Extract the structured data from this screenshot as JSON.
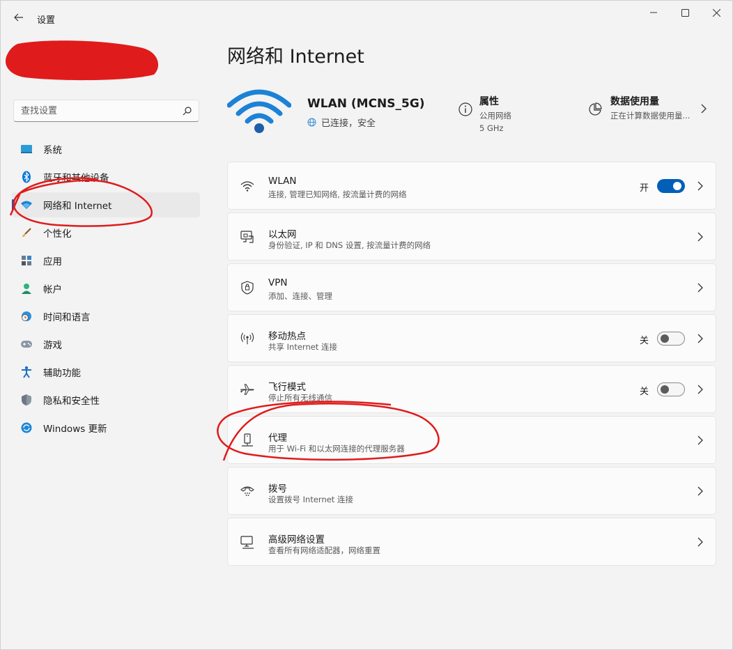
{
  "window": {
    "title": "设置",
    "controls": [
      "minimize",
      "maximize",
      "close"
    ]
  },
  "search": {
    "placeholder": "查找设置"
  },
  "sidebar": {
    "items": [
      {
        "label": "系统",
        "icon": "system-icon",
        "active": false
      },
      {
        "label": "蓝牙和其他设备",
        "icon": "bluetooth-icon",
        "active": false
      },
      {
        "label": "网络和 Internet",
        "icon": "wifi-icon",
        "active": true
      },
      {
        "label": "个性化",
        "icon": "brush-icon",
        "active": false
      },
      {
        "label": "应用",
        "icon": "apps-icon",
        "active": false
      },
      {
        "label": "帐户",
        "icon": "person-icon",
        "active": false
      },
      {
        "label": "时间和语言",
        "icon": "globe-clock-icon",
        "active": false
      },
      {
        "label": "游戏",
        "icon": "gamepad-icon",
        "active": false
      },
      {
        "label": "辅助功能",
        "icon": "accessibility-icon",
        "active": false
      },
      {
        "label": "隐私和安全性",
        "icon": "shield-icon",
        "active": false
      },
      {
        "label": "Windows 更新",
        "icon": "update-icon",
        "active": false
      }
    ]
  },
  "main": {
    "title": "网络和 Internet",
    "network": {
      "name": "WLAN (MCNS_5G)",
      "status": "已连接，安全",
      "properties": {
        "title": "属性",
        "line1": "公用网络",
        "line2": "5 GHz"
      },
      "usage": {
        "title": "数据使用量",
        "line1": "正在计算数据使用量..."
      }
    },
    "cards": [
      {
        "title": "WLAN",
        "subtitle": "连接, 管理已知网络, 按流量计费的网络",
        "icon": "wifi-icon",
        "toggle": "开"
      },
      {
        "title": "以太网",
        "subtitle": "身份验证, IP 和 DNS 设置, 按流量计费的网络",
        "icon": "ethernet-icon",
        "toggle": null
      },
      {
        "title": "VPN",
        "subtitle": "添加、连接、管理",
        "icon": "vpn-shield-icon",
        "toggle": null
      },
      {
        "title": "移动热点",
        "subtitle": "共享 Internet 连接",
        "icon": "hotspot-icon",
        "toggle": "关"
      },
      {
        "title": "飞行模式",
        "subtitle": "停止所有无线通信",
        "icon": "airplane-icon",
        "toggle": "关"
      },
      {
        "title": "代理",
        "subtitle": "用于 Wi-Fi 和以太网连接的代理服务器",
        "icon": "proxy-icon",
        "toggle": null
      },
      {
        "title": "拨号",
        "subtitle": "设置拨号 Internet 连接",
        "icon": "dialup-icon",
        "toggle": null
      },
      {
        "title": "高级网络设置",
        "subtitle": "查看所有网络适配器，网络重置",
        "icon": "advanced-network-icon",
        "toggle": null
      }
    ]
  },
  "colors": {
    "accent": "#005fb8",
    "annotation": "#e01b1b",
    "background": "#f3f3f3"
  }
}
